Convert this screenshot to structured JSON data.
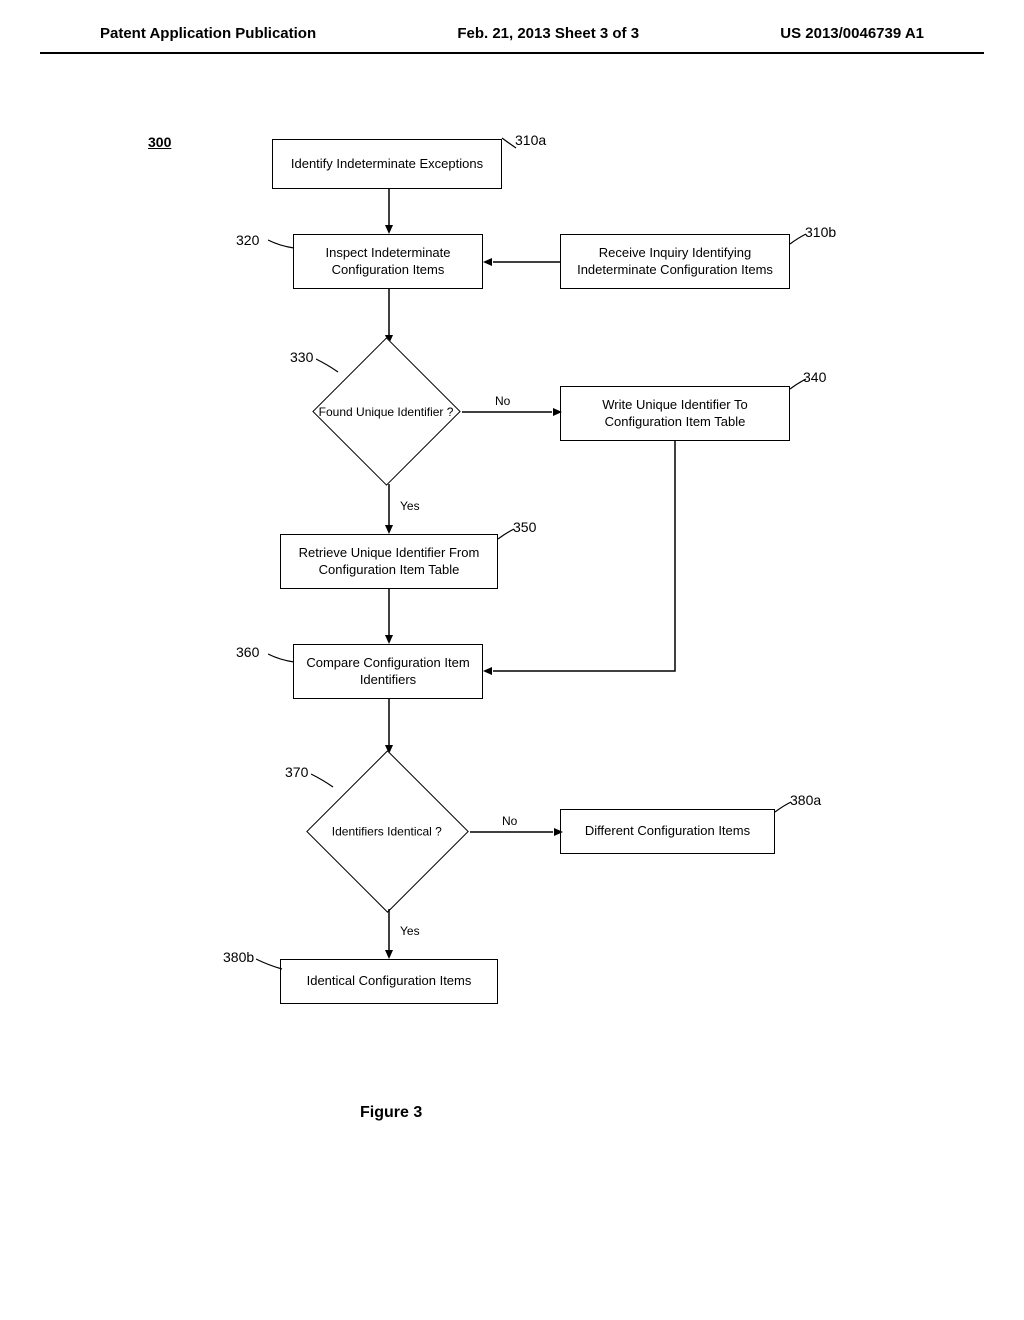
{
  "header": {
    "left": "Patent Application Publication",
    "center": "Feb. 21, 2013  Sheet 3 of 3",
    "right": "US 2013/0046739 A1"
  },
  "diagram": {
    "ref_main": "300",
    "boxes": {
      "b310a": {
        "text": "Identify Indeterminate Exceptions",
        "ref": "310a"
      },
      "b320": {
        "text": "Inspect Indeterminate Configuration Items",
        "ref": "320"
      },
      "b310b": {
        "text": "Receive Inquiry Identifying Indeterminate Configuration Items",
        "ref": "310b"
      },
      "b340": {
        "text": "Write Unique Identifier To Configuration Item Table",
        "ref": "340"
      },
      "b350": {
        "text": "Retrieve Unique Identifier From Configuration Item Table",
        "ref": "350"
      },
      "b360": {
        "text": "Compare Configuration Item Identifiers",
        "ref": "360"
      },
      "b380a": {
        "text": "Different Configuration Items",
        "ref": "380a"
      },
      "b380b": {
        "text": "Identical Configuration Items",
        "ref": "380b"
      }
    },
    "diamonds": {
      "d330": {
        "text": "Found Unique Identifier ?",
        "ref": "330"
      },
      "d370": {
        "text": "Identifiers Identical ?",
        "ref": "370"
      }
    },
    "labels": {
      "yes": "Yes",
      "no": "No"
    }
  },
  "figure_caption": "Figure 3"
}
